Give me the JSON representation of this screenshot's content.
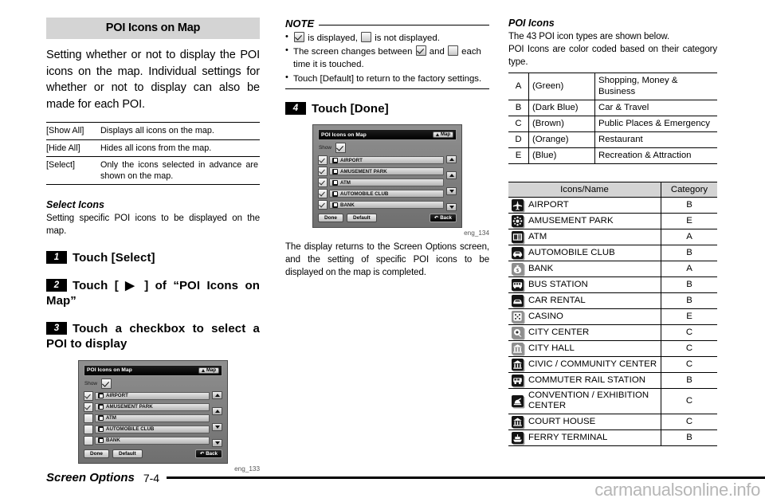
{
  "left": {
    "heading": "POI Icons on Map",
    "intro": "Setting whether or not to display the POI icons on the map. Individual settings for whether or not to display can also be made for each POI.",
    "defs": [
      {
        "term": "[Show All]",
        "desc": "Displays all icons on the map."
      },
      {
        "term": "[Hide All]",
        "desc": "Hides all icons from the map."
      },
      {
        "term": "[Select]",
        "desc": "Only the icons selected in advance are shown on the map."
      }
    ],
    "select_icons": {
      "subhead": "Select Icons",
      "body": "Setting specific POI icons to be displayed on the map."
    },
    "steps": [
      {
        "num": "1",
        "text": "Touch [Select]"
      },
      {
        "num": "2",
        "text": "Touch [ ▶ ] of “POI Icons on Map”"
      },
      {
        "num": "3",
        "text": "Touch a checkbox to select a POI to display"
      }
    ],
    "screenshot": {
      "title": "POI Icons on Map",
      "map_button": "Map",
      "show_label": "Show",
      "show_checked": true,
      "rows": [
        {
          "label": "AIRPORT",
          "checked": true
        },
        {
          "label": "AMUSEMENT PARK",
          "checked": true
        },
        {
          "label": "ATM",
          "checked": false
        },
        {
          "label": "AUTOMOBILE CLUB",
          "checked": false
        },
        {
          "label": "BANK",
          "checked": false
        }
      ],
      "done_label": "Done",
      "default_label": "Default",
      "back_label": "Back",
      "caption": "eng_133"
    }
  },
  "middle": {
    "note_title": "NOTE",
    "notes": [
      "is displayed,  is not displayed.",
      "The screen changes between  and  each time it is touched.",
      "Touch [Default] to return to the factory settings."
    ],
    "note_fragments": {
      "n1a": "is displayed,",
      "n1b": "is not displayed.",
      "n2a": "The screen changes between",
      "n2b": "and",
      "n2c": "each time it is touched.",
      "n3": "Touch [Default] to return to the factory settings."
    },
    "step": {
      "num": "4",
      "text": "Touch [Done]"
    },
    "screenshot": {
      "title": "POI Icons on Map",
      "map_button": "Map",
      "show_label": "Show",
      "show_checked": true,
      "rows": [
        {
          "label": "AIRPORT",
          "checked": true
        },
        {
          "label": "AMUSEMENT PARK",
          "checked": true
        },
        {
          "label": "ATM",
          "checked": true
        },
        {
          "label": "AUTOMOBILE CLUB",
          "checked": true
        },
        {
          "label": "BANK",
          "checked": true
        }
      ],
      "done_label": "Done",
      "default_label": "Default",
      "back_label": "Back",
      "caption": "eng_134"
    },
    "closing": "The display returns to the Screen Options screen, and the setting of specific POI icons to be displayed on the map is completed."
  },
  "right": {
    "subhead": "POI Icons",
    "intro_line1": "The 43 POI icon types are shown below.",
    "intro_line2": "POI Icons are color coded based on their category type.",
    "categories": [
      {
        "key": "A",
        "color": "(Green)",
        "desc": "Shopping, Money & Business"
      },
      {
        "key": "B",
        "color": "(Dark Blue)",
        "desc": "Car & Travel"
      },
      {
        "key": "C",
        "color": "(Brown)",
        "desc": "Public Places & Emergency"
      },
      {
        "key": "D",
        "color": "(Orange)",
        "desc": "Restaurant"
      },
      {
        "key": "E",
        "color": "(Blue)",
        "desc": "Recreation & Attraction"
      }
    ],
    "icon_table": {
      "headers": [
        "Icons/Name",
        "Category"
      ],
      "rows": [
        {
          "icon": "airport-icon",
          "name": "AIRPORT",
          "category": "B"
        },
        {
          "icon": "amusement-park-icon",
          "name": "AMUSEMENT PARK",
          "category": "E"
        },
        {
          "icon": "atm-icon",
          "name": "ATM",
          "category": "A"
        },
        {
          "icon": "automobile-club-icon",
          "name": "AUTOMOBILE CLUB",
          "category": "B"
        },
        {
          "icon": "bank-icon",
          "name": "BANK",
          "category": "A"
        },
        {
          "icon": "bus-station-icon",
          "name": "BUS STATION",
          "category": "B"
        },
        {
          "icon": "car-rental-icon",
          "name": "CAR RENTAL",
          "category": "B"
        },
        {
          "icon": "casino-icon",
          "name": "CASINO",
          "category": "E"
        },
        {
          "icon": "city-center-icon",
          "name": "CITY CENTER",
          "category": "C"
        },
        {
          "icon": "city-hall-icon",
          "name": "CITY HALL",
          "category": "C"
        },
        {
          "icon": "civic-community-center-icon",
          "name": "CIVIC / COMMUNITY CENTER",
          "category": "C"
        },
        {
          "icon": "commuter-rail-station-icon",
          "name": "COMMUTER RAIL STATION",
          "category": "B"
        },
        {
          "icon": "convention-exhibition-center-icon",
          "name": "CONVENTION / EXHIBITION CENTER",
          "category": "C"
        },
        {
          "icon": "court-house-icon",
          "name": "COURT HOUSE",
          "category": "C"
        },
        {
          "icon": "ferry-terminal-icon",
          "name": "FERRY TERMINAL",
          "category": "B"
        }
      ]
    }
  },
  "footer": {
    "section": "Screen Options",
    "page": "7-4",
    "watermark": "carmanualsonline.info"
  }
}
